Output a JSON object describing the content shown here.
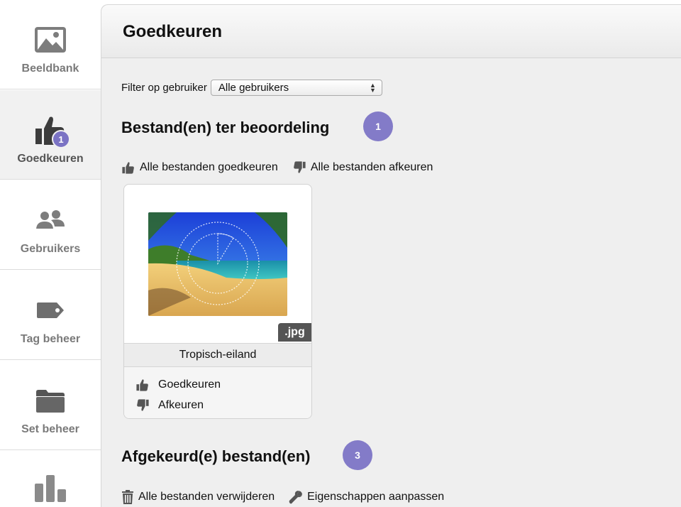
{
  "sidebar": {
    "items": [
      {
        "label": "Beeldbank",
        "icon": "image-icon"
      },
      {
        "label": "Goedkeuren",
        "icon": "thumbs-up-icon",
        "badge": "1",
        "active": true
      },
      {
        "label": "Gebruikers",
        "icon": "users-icon"
      },
      {
        "label": "Tag beheer",
        "icon": "tag-icon"
      },
      {
        "label": "Set beheer",
        "icon": "folder-icon"
      },
      {
        "label": "",
        "icon": "bar-chart-icon"
      }
    ]
  },
  "header": {
    "title": "Goedkeuren"
  },
  "filter": {
    "label": "Filter op gebruiker",
    "selected": "Alle gebruikers"
  },
  "pending": {
    "title": "Bestand(en) ter beoordeling",
    "count": "1",
    "approve_all": "Alle bestanden goedkeuren",
    "reject_all": "Alle bestanden afkeuren",
    "files": [
      {
        "name": "Tropisch-eiland",
        "ext": ".jpg",
        "approve": "Goedkeuren",
        "reject": "Afkeuren"
      }
    ]
  },
  "rejected": {
    "title": "Afgekeurd(e) bestand(en)",
    "count": "3",
    "delete_all": "Alle bestanden verwijderen",
    "edit_props": "Eigenschappen aanpassen"
  },
  "colors": {
    "badge": "#837bc8",
    "panel": "#efefef",
    "ext_tag": "#555555"
  }
}
